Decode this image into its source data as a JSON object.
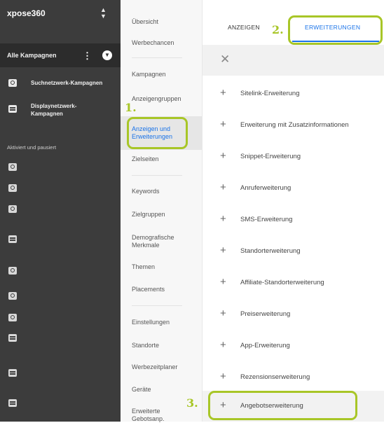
{
  "sidebar": {
    "account_name": "xpose360",
    "all_campaigns_label": "Alle Kampagnen",
    "campaigns": [
      {
        "icon": "search-icon",
        "label": "Suchnetzwerk-Kampagnen"
      },
      {
        "icon": "display-icon",
        "label": "Displaynetzwerk-Kampagnen"
      }
    ],
    "section_label": "Aktiviert und pausiert",
    "mini_icons": [
      "search-icon",
      "search-icon",
      "search-icon",
      "display-icon",
      "search-icon",
      "search-icon",
      "search-icon",
      "display-icon",
      "display-icon",
      "display-icon"
    ]
  },
  "nav": {
    "items": [
      {
        "label": "Übersicht"
      },
      {
        "label": "Werbechancen"
      },
      {
        "label": "Kampagnen"
      },
      {
        "label": "Anzeigengruppen"
      },
      {
        "label": "Anzeigen und Erweiterungen"
      },
      {
        "label": "Zielseiten"
      },
      {
        "label": "Keywords"
      },
      {
        "label": "Zielgruppen"
      },
      {
        "label": "Demografische Merkmale"
      },
      {
        "label": "Themen"
      },
      {
        "label": "Placements"
      },
      {
        "label": "Einstellungen"
      },
      {
        "label": "Standorte"
      },
      {
        "label": "Werbezeitplaner"
      },
      {
        "label": "Geräte"
      },
      {
        "label": "Erweiterte Gebotsanp."
      }
    ]
  },
  "tabs": {
    "ads": "ANZEIGEN",
    "extensions": "ERWEITERUNGEN"
  },
  "extensions": [
    "Sitelink-Erweiterung",
    "Erweiterung mit Zusatzinformationen",
    "Snippet-Erweiterung",
    "Anruferweiterung",
    "SMS-Erweiterung",
    "Standorterweiterung",
    "Affiliate-Standorterweiterung",
    "Preiserweiterung",
    "App-Erweiterung",
    "Rezensionserweiterung",
    "Angebotserweiterung"
  ],
  "annotations": {
    "step1": "1.",
    "step2": "2.",
    "step3": "3."
  },
  "colors": {
    "accent": "#1a73e8",
    "annotation": "#a8c627",
    "sidebar_bg": "#3c3c3c"
  }
}
